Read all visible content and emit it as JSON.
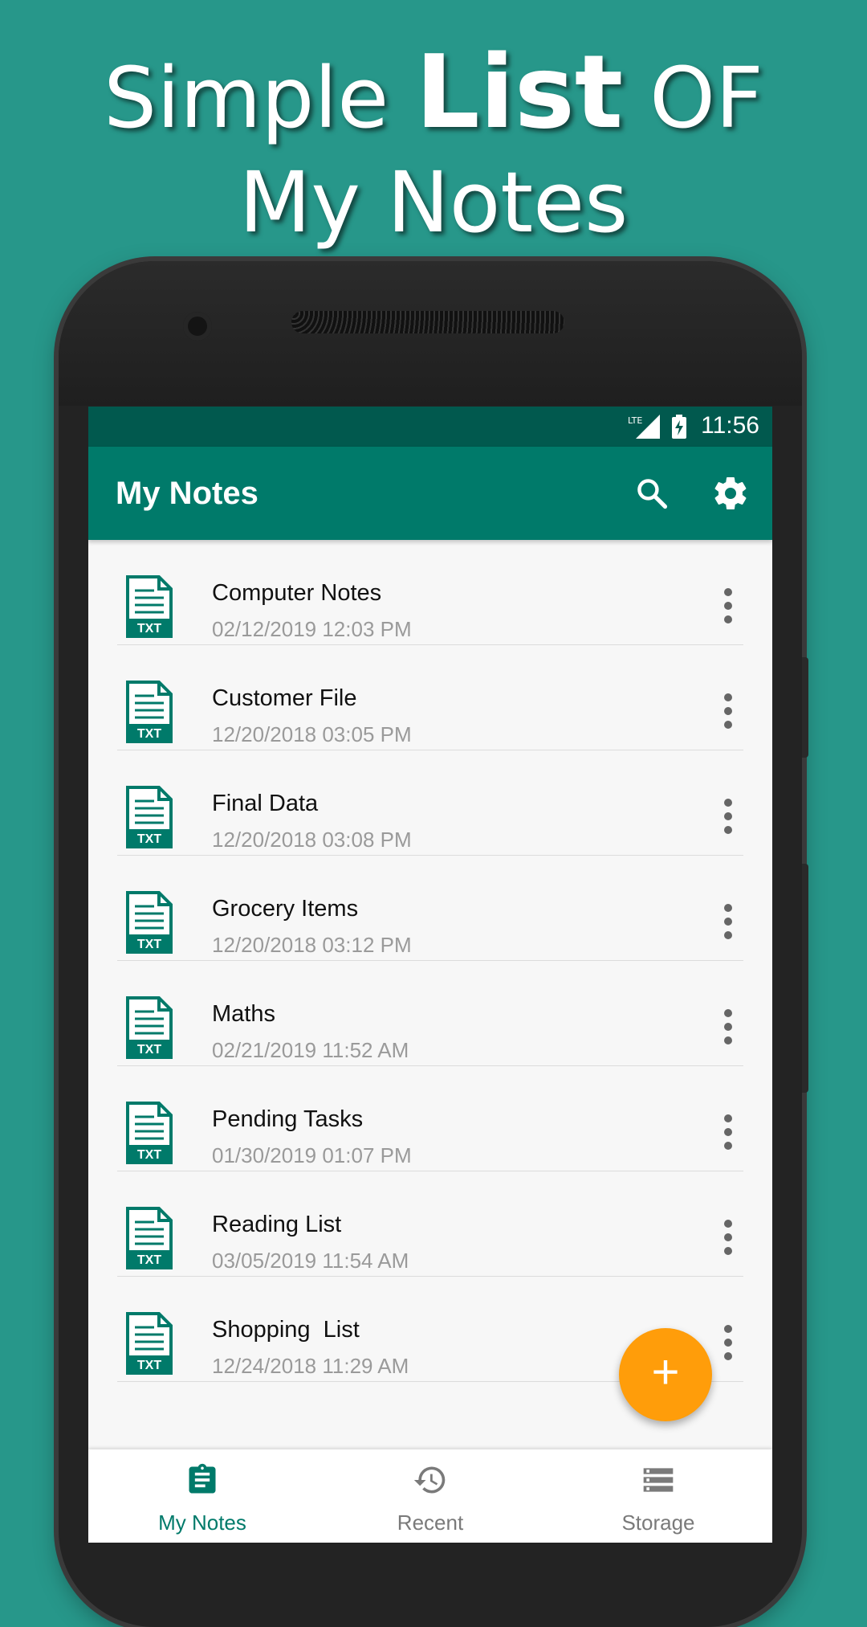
{
  "promo": {
    "line1_part1": "Simple ",
    "line1_bold": "List",
    "line1_part2": " OF",
    "line2": "My Notes"
  },
  "status_bar": {
    "network": "LTE",
    "time": "11:56"
  },
  "app_bar": {
    "title": "My Notes",
    "search_icon": "search-icon",
    "settings_icon": "gear-icon"
  },
  "notes": [
    {
      "title": "Computer Notes",
      "date": "02/12/2019 12:03 PM",
      "icon_label": "TXT"
    },
    {
      "title": "Customer File",
      "date": "12/20/2018 03:05 PM",
      "icon_label": "TXT"
    },
    {
      "title": "Final Data",
      "date": "12/20/2018 03:08 PM",
      "icon_label": "TXT"
    },
    {
      "title": "Grocery Items",
      "date": "12/20/2018 03:12 PM",
      "icon_label": "TXT"
    },
    {
      "title": "Maths",
      "date": "02/21/2019 11:52 AM",
      "icon_label": "TXT"
    },
    {
      "title": "Pending Tasks",
      "date": "01/30/2019 01:07 PM",
      "icon_label": "TXT"
    },
    {
      "title": "Reading List",
      "date": "03/05/2019 11:54 AM",
      "icon_label": "TXT"
    },
    {
      "title": "Shopping  List",
      "date": "12/24/2018 11:29 AM",
      "icon_label": "TXT"
    }
  ],
  "fab": {
    "label": "+"
  },
  "bottom_nav": [
    {
      "label": "My Notes",
      "icon": "clipboard-icon",
      "active": true
    },
    {
      "label": "Recent",
      "icon": "history-icon",
      "active": false
    },
    {
      "label": "Storage",
      "icon": "storage-icon",
      "active": false
    }
  ],
  "colors": {
    "background": "#27978a",
    "primary": "#007a6a",
    "primary_dark": "#01594e",
    "accent": "#ff9d0a",
    "inactive_nav": "#7a7a7a"
  }
}
